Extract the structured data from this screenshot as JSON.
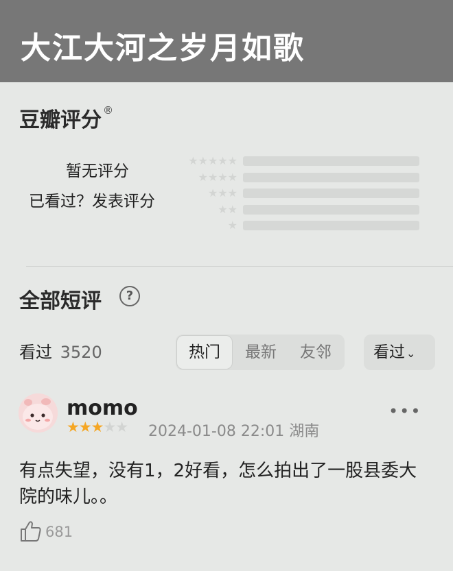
{
  "header": {
    "title": "大江大河之岁月如歌"
  },
  "rating": {
    "heading": "豆瓣评分",
    "registered_mark": "®",
    "status": "暂无评分",
    "action": "已看过？发表评分",
    "star_rows": [
      {
        "stars": "★★★★★"
      },
      {
        "stars": "★★★★"
      },
      {
        "stars": "★★★"
      },
      {
        "stars": "★★"
      },
      {
        "stars": "★"
      }
    ]
  },
  "reviews": {
    "title": "全部短评",
    "help_icon": "?",
    "watched_label": "看过",
    "watched_count": "3520",
    "tabs": [
      {
        "label": "热门",
        "active": true
      },
      {
        "label": "最新",
        "active": false
      },
      {
        "label": "友邻",
        "active": false
      }
    ],
    "sort": {
      "label": "看过",
      "icon": "chevron-down-icon"
    }
  },
  "review": {
    "username": "momo",
    "stars_on": "★★★",
    "stars_off": "★★",
    "rating": 3,
    "datetime": "2024-01-08 22:01",
    "location": "湖南",
    "text": "有点失望，没有1，2好看，怎么拍出了一股县委大院的味儿。。",
    "likes": "681",
    "more_icon": "•••"
  },
  "colors": {
    "header_bg": "#777777",
    "page_bg": "#e6e8e6",
    "star_accent": "#f5a623"
  }
}
